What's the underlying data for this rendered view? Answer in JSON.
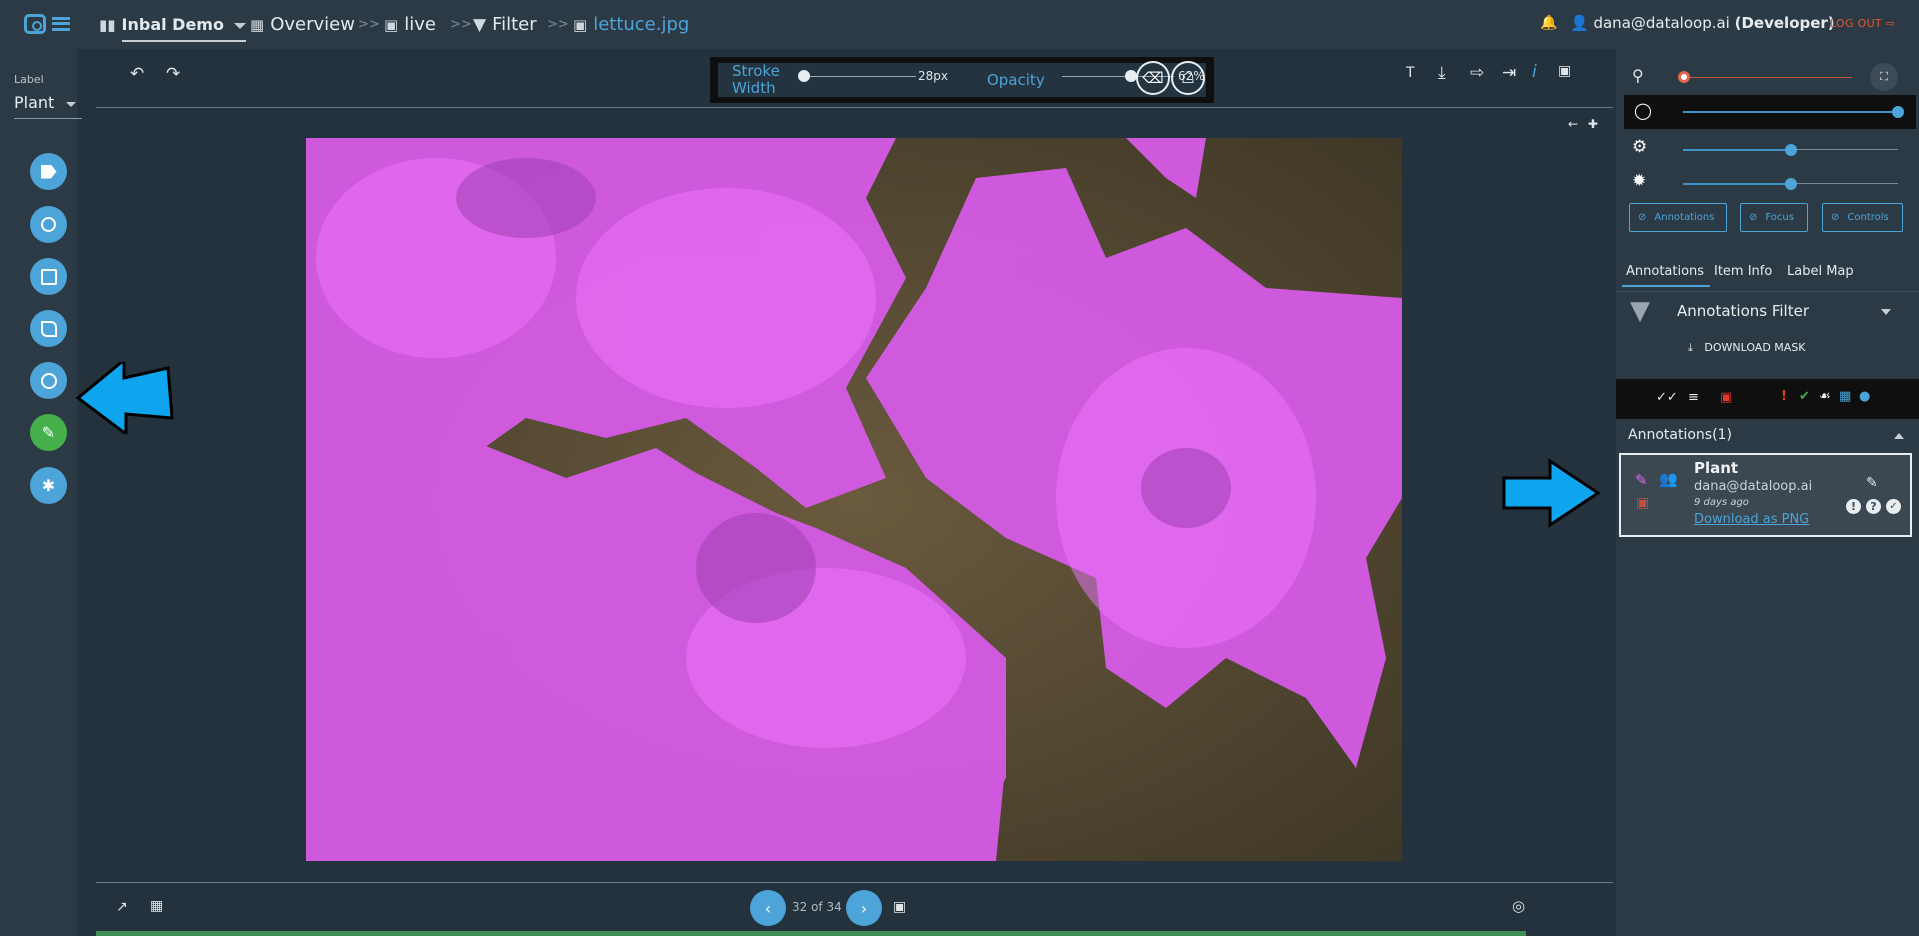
{
  "topbar": {
    "project": "Inbal Demo",
    "overview": "Overview",
    "dataset": "live",
    "filter": "Filter",
    "file": "lettuce.jpg",
    "separator": ">>",
    "user_email": "dana@dataloop.ai",
    "user_role": "(Developer)",
    "logout": "LOG OUT"
  },
  "left_panel": {
    "label_caption": "Label",
    "label_value": "Plant",
    "tools": [
      "tag-icon",
      "point-icon",
      "box-icon",
      "polygon-icon",
      "circle-icon",
      "brush-icon",
      "bug-icon"
    ],
    "active_tool": "brush-icon"
  },
  "toolbar": {
    "stroke_width_label": "Stroke Width",
    "stroke_width_value": "28px",
    "stroke_width_fraction": 0.0,
    "opacity_label": "Opacity",
    "opacity_value": "62%",
    "opacity_fraction": 0.62
  },
  "pager": {
    "text": "32 of 34"
  },
  "right_panel": {
    "zoom_fraction": 0.0,
    "opacity_fraction": 1.0,
    "brightness_fraction": 0.5,
    "contrast_fraction": 0.5,
    "toggles": [
      "Annotations",
      "Focus",
      "Controls"
    ],
    "tabs": [
      "Annotations",
      "Item Info",
      "Label Map"
    ],
    "filter_title": "Annotations Filter",
    "download_mask": "DOWNLOAD MASK",
    "annotations_header": "Annotations(1)",
    "annotation": {
      "label": "Plant",
      "creator": "dana@dataloop.ai",
      "age": "9 days ago",
      "download": "Download as PNG"
    }
  },
  "colors": {
    "accent": "#4ca4d9",
    "active_tool": "#45b04a",
    "mask": "#e065f0",
    "logout": "#e4572e",
    "bell": "#f3c11b",
    "callout_arrow": "#0ea5ee"
  }
}
